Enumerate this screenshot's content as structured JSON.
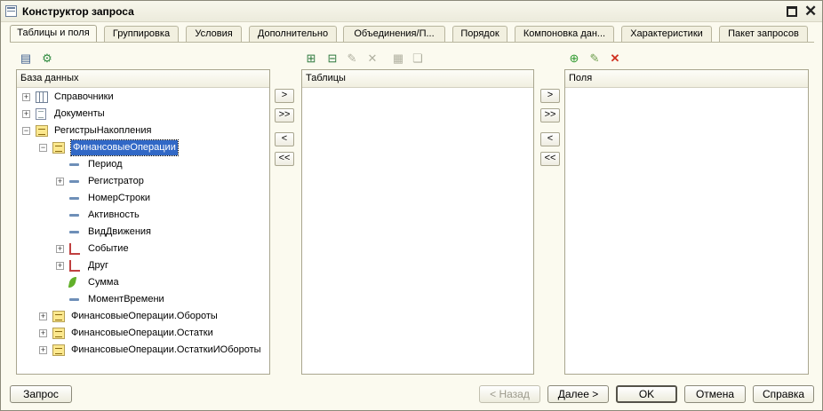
{
  "window": {
    "title": "Конструктор запроса"
  },
  "tabs": [
    "Таблицы и поля",
    "Группировка",
    "Условия",
    "Дополнительно",
    "Объединения/П...",
    "Порядок",
    "Компоновка дан...",
    "Характеристики",
    "Пакет запросов"
  ],
  "active_tab": "Таблицы и поля",
  "left_panel": {
    "header": "База данных",
    "tree": [
      {
        "label": "Справочники",
        "icon": "catalog-icon",
        "expander": "+"
      },
      {
        "label": "Документы",
        "icon": "document-icon",
        "expander": "+"
      },
      {
        "label": "РегистрыНакопления",
        "icon": "register-icon",
        "expander": "−"
      },
      {
        "label": "ФинансовыеОперации",
        "icon": "register-icon",
        "expander": "−",
        "selected": true
      },
      {
        "label": "Период",
        "icon": "field-icon"
      },
      {
        "label": "Регистратор",
        "icon": "field-icon",
        "expander": "+"
      },
      {
        "label": "НомерСтроки",
        "icon": "field-icon"
      },
      {
        "label": "Активность",
        "icon": "field-icon"
      },
      {
        "label": "ВидДвижения",
        "icon": "field-icon"
      },
      {
        "label": "Событие",
        "icon": "link-icon",
        "expander": "+"
      },
      {
        "label": "Друг",
        "icon": "link-icon",
        "expander": "+"
      },
      {
        "label": "Сумма",
        "icon": "resource-icon"
      },
      {
        "label": "МоментВремени",
        "icon": "field-icon"
      },
      {
        "label": "ФинансовыеОперации.Обороты",
        "icon": "register-icon",
        "expander": "+"
      },
      {
        "label": "ФинансовыеОперации.Остатки",
        "icon": "register-icon",
        "expander": "+"
      },
      {
        "label": "ФинансовыеОперации.ОстаткиИОбороты",
        "icon": "register-icon",
        "expander": "+"
      }
    ]
  },
  "middle_panel": {
    "header": "Таблицы"
  },
  "right_panel": {
    "header": "Поля"
  },
  "move_buttons": {
    "add": ">",
    "add_all": ">>",
    "remove": "<",
    "remove_all": "<<"
  },
  "footer": {
    "query": "Запрос",
    "back": "< Назад",
    "next": "Далее >",
    "ok": "OK",
    "cancel": "Отмена",
    "help": "Справка"
  }
}
